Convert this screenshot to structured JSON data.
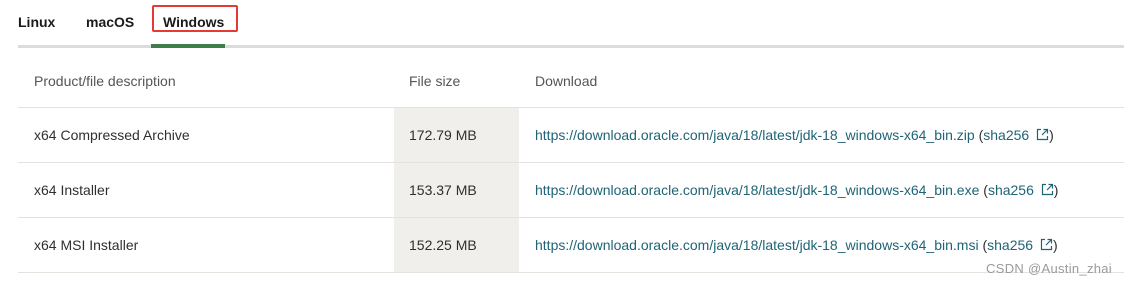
{
  "tabs": [
    {
      "label": "Linux"
    },
    {
      "label": "macOS"
    },
    {
      "label": "Windows",
      "active": true
    }
  ],
  "table": {
    "headers": {
      "description": "Product/file description",
      "file_size": "File size",
      "download": "Download"
    },
    "rows": [
      {
        "description": "x64 Compressed Archive",
        "file_size": "172.79 MB",
        "url": "https://download.oracle.com/java/18/latest/jdk-18_windows-x64_bin.zip",
        "checksum_label": "sha256"
      },
      {
        "description": "x64 Installer",
        "file_size": "153.37 MB",
        "url": "https://download.oracle.com/java/18/latest/jdk-18_windows-x64_bin.exe",
        "checksum_label": "sha256"
      },
      {
        "description": "x64 MSI Installer",
        "file_size": "152.25 MB",
        "url": "https://download.oracle.com/java/18/latest/jdk-18_windows-x64_bin.msi",
        "checksum_label": "sha256"
      }
    ]
  },
  "watermark": "CSDN @Austin_zhai",
  "colors": {
    "active_tab_bar": "#3e7c4a",
    "highlight_box": "#e53935",
    "link": "#1f6476",
    "size_column_bg": "#f1efec"
  }
}
